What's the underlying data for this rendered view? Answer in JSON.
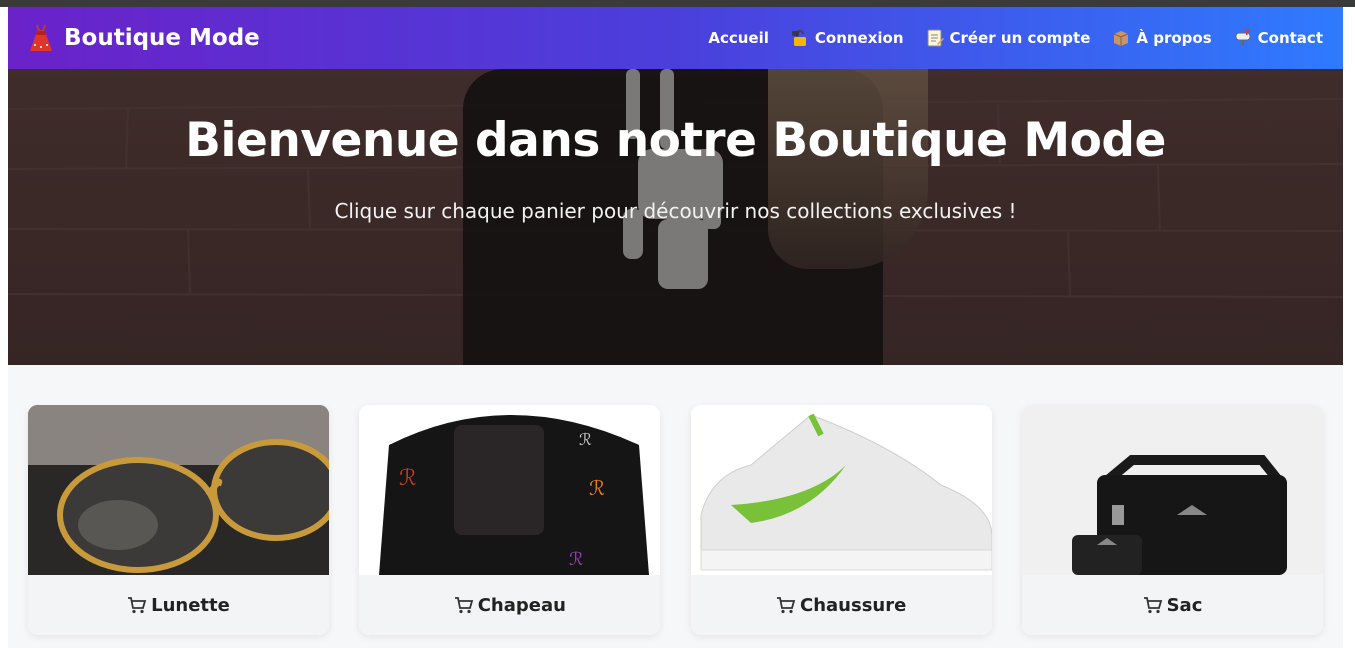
{
  "brand": {
    "name": "Boutique Mode",
    "icon": "dress-icon"
  },
  "nav": [
    {
      "label": "Accueil",
      "icon": ""
    },
    {
      "label": "Connexion",
      "icon": "lock-icon"
    },
    {
      "label": "Créer un compte",
      "icon": "memo-icon"
    },
    {
      "label": "À propos",
      "icon": "package-icon"
    },
    {
      "label": "Contact",
      "icon": "mailbox-icon"
    }
  ],
  "hero": {
    "title": "Bienvenue dans notre Boutique Mode",
    "subtitle": "Clique sur chaque panier pour découvrir nos collections exclusives !"
  },
  "products": [
    {
      "label": "Lunette",
      "icon": "cart-icon"
    },
    {
      "label": "Chapeau",
      "icon": "cart-icon"
    },
    {
      "label": "Chaussure",
      "icon": "cart-icon"
    },
    {
      "label": "Sac",
      "icon": "cart-icon"
    }
  ],
  "colors": {
    "nav_start": "#6a22c9",
    "nav_end": "#2e7bff",
    "page_bg": "#f6f7f9"
  }
}
